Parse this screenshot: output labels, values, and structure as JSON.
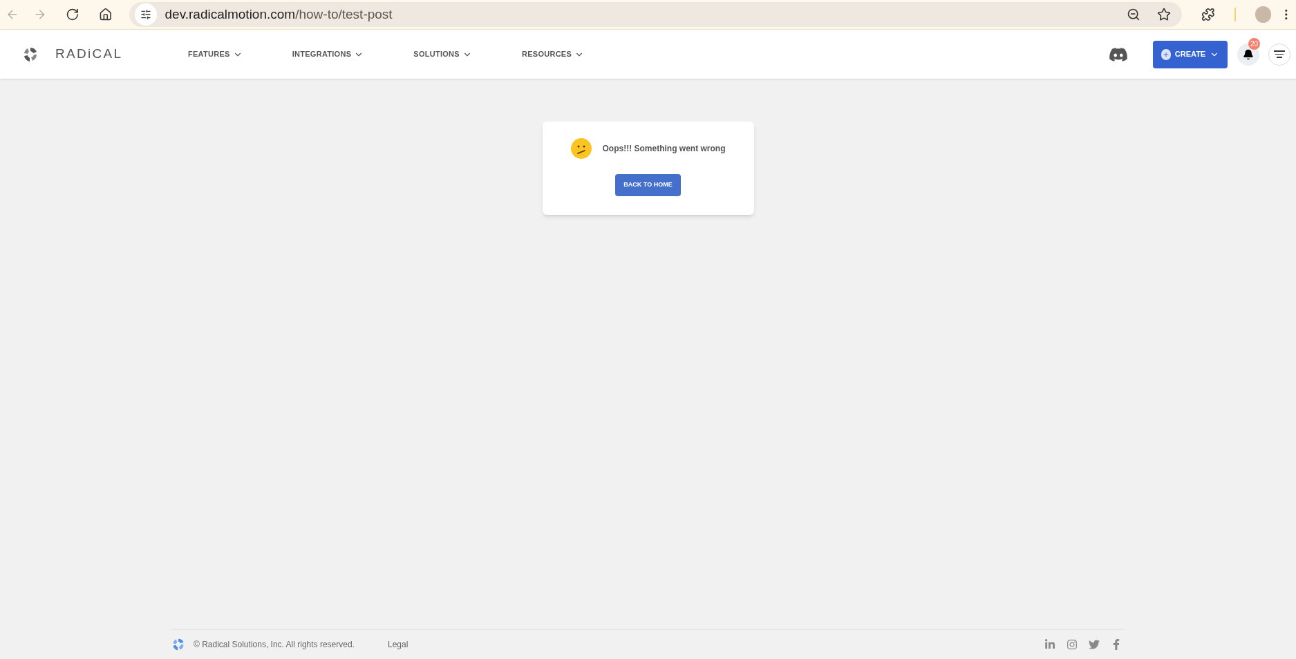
{
  "browser": {
    "url_host": "dev.radicalmotion.com",
    "url_path": "/how-to/test-post"
  },
  "nav": {
    "logo": "RADiCAL",
    "menu": [
      {
        "label": "FEATURES"
      },
      {
        "label": "INTEGRATIONS"
      },
      {
        "label": "SOLUTIONS"
      },
      {
        "label": "RESOURCES"
      }
    ],
    "create_button": "CREATE",
    "notification_count": "20"
  },
  "error_card": {
    "message": "Oops!!! Something went wrong",
    "button": "BACK TO HOME"
  },
  "footer": {
    "copyright": "© Radical Solutions, Inc. All rights reserved.",
    "links": [
      "Legal"
    ]
  }
}
